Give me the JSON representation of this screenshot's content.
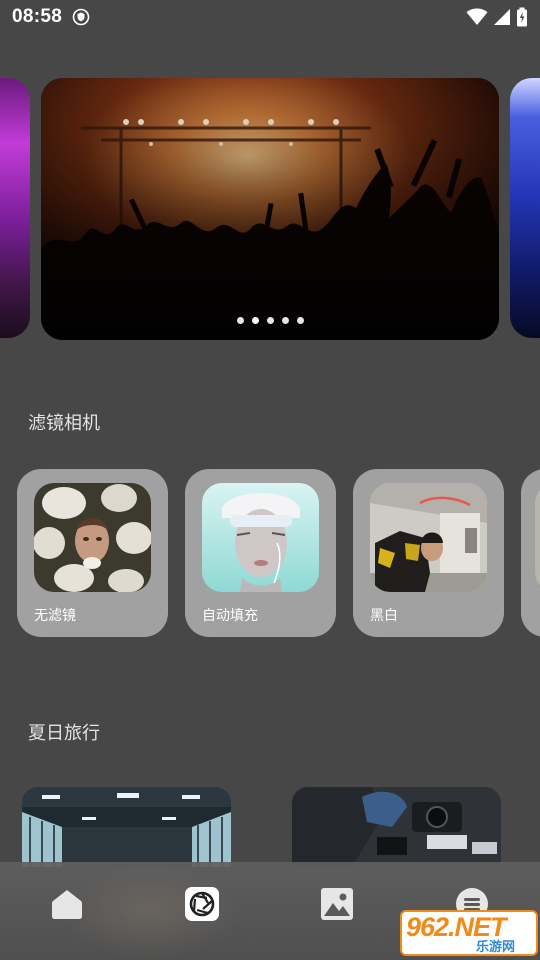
{
  "status_bar": {
    "time": "08:58",
    "icons": [
      "shield-icon",
      "wifi-icon",
      "signal-icon",
      "battery-icon"
    ]
  },
  "carousel": {
    "page_count": 5,
    "active_index": 1
  },
  "sections": {
    "filter_camera": {
      "title": "滤镜相机",
      "cards": [
        {
          "label": "无滤镜"
        },
        {
          "label": "自动填充"
        },
        {
          "label": "黑白"
        }
      ]
    },
    "summer_trip": {
      "title": "夏日旅行"
    }
  },
  "bottom_nav": {
    "items": [
      {
        "icon": "home-icon"
      },
      {
        "icon": "camera-aperture-icon",
        "active": true
      },
      {
        "icon": "image-icon"
      },
      {
        "icon": "menu-icon"
      }
    ]
  },
  "watermark": {
    "brand": "962.NET",
    "sub": "乐游网"
  },
  "colors": {
    "background": "#474747",
    "card": "#a1a1a1",
    "watermark_orange": "#f08a18",
    "watermark_blue": "#2d8ad6"
  }
}
